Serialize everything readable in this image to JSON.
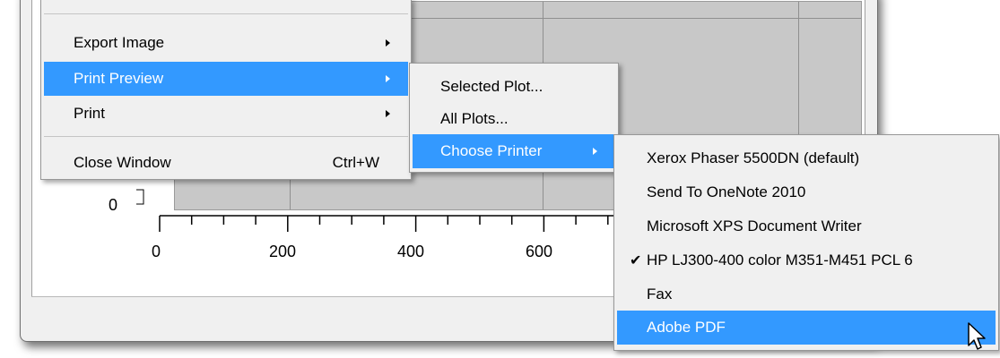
{
  "plot": {
    "y_tick_label": "0",
    "x_tick_labels": [
      "0",
      "200",
      "400",
      "600"
    ]
  },
  "menu_main": {
    "items": [
      {
        "label": "Export Image",
        "has_submenu": true
      },
      {
        "label": "Print Preview",
        "has_submenu": true
      },
      {
        "label": "Print",
        "has_submenu": true
      },
      {
        "label": "Close Window",
        "shortcut": "Ctrl+W"
      }
    ]
  },
  "menu_print_preview": {
    "items": [
      {
        "label": "Selected Plot..."
      },
      {
        "label": "All Plots..."
      },
      {
        "label": "Choose Printer",
        "has_submenu": true
      }
    ]
  },
  "menu_printers": {
    "items": [
      {
        "label": "Xerox Phaser 5500DN (default)"
      },
      {
        "label": "Send To OneNote 2010"
      },
      {
        "label": "Microsoft XPS Document Writer"
      },
      {
        "label": "HP LJ300-400 color M351-M451 PCL 6",
        "checked": true
      },
      {
        "label": "Fax"
      },
      {
        "label": "Adobe PDF"
      }
    ]
  },
  "colors": {
    "highlight": "#3399ff",
    "menu_background": "#f0f0f0",
    "plot_background": "#c8c8c8"
  }
}
